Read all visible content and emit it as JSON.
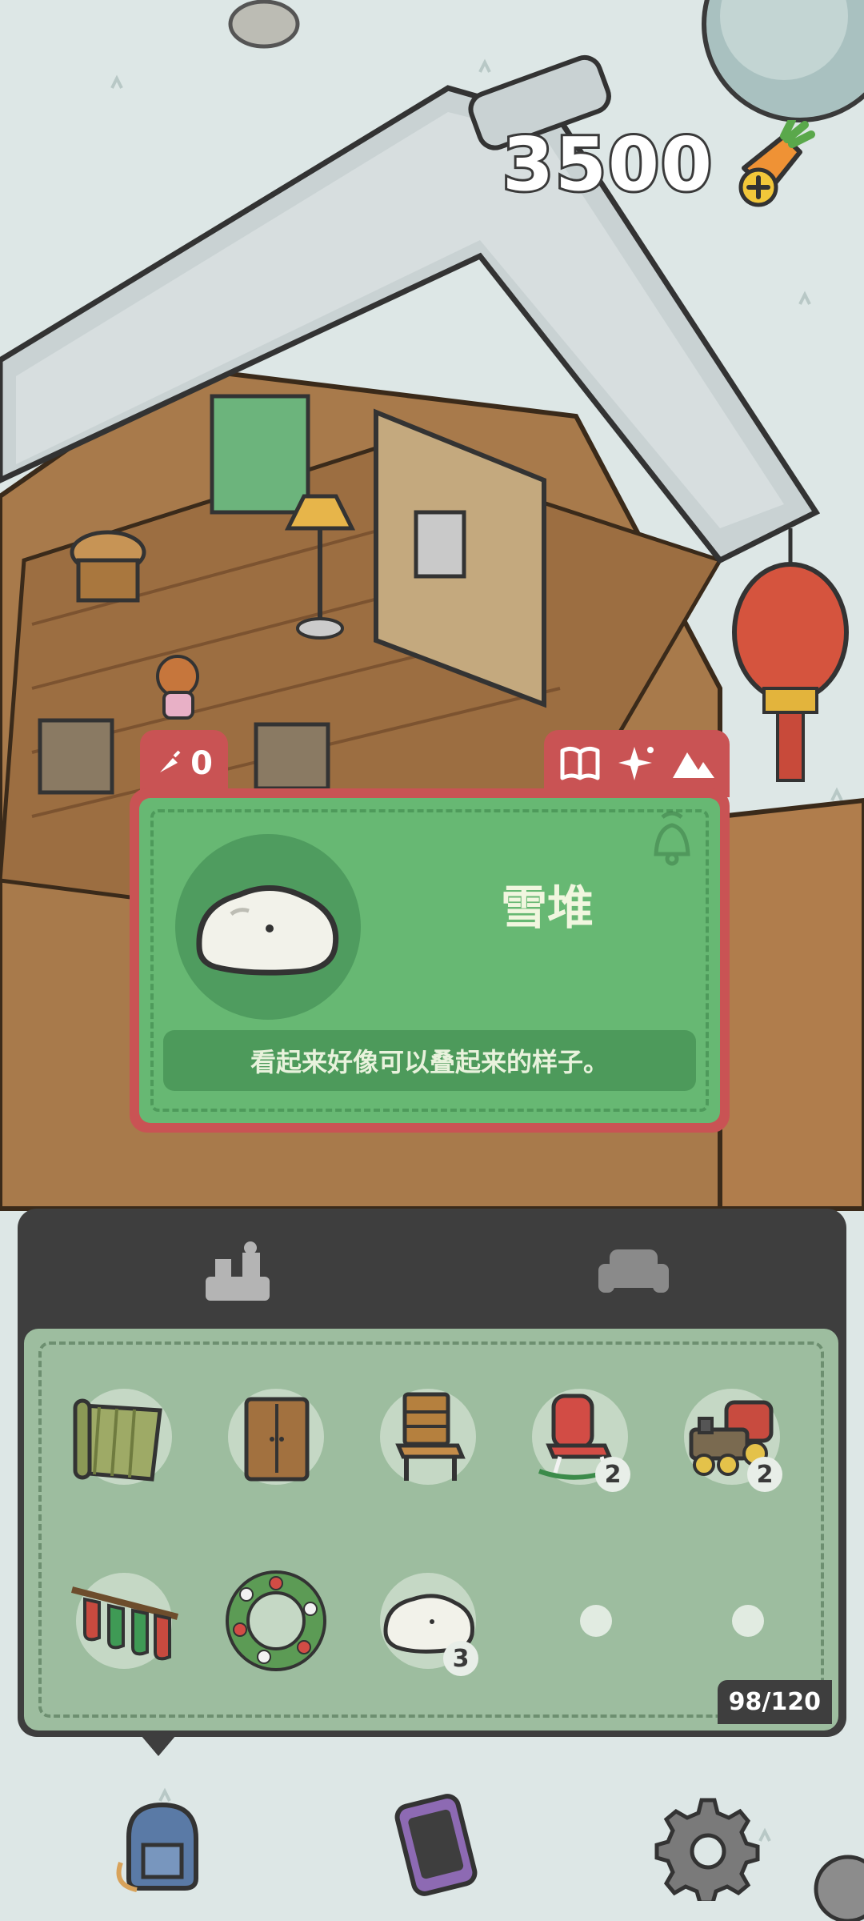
{
  "currency": {
    "amount": "3500",
    "icon": "carrot-add-icon"
  },
  "detail": {
    "tab_count": "0",
    "item_name": "雪堆",
    "item_description": "看起来好像可以叠起来的样子。",
    "actions": [
      "book-icon",
      "sparkle-icon",
      "mountain-icon"
    ]
  },
  "inventory": {
    "tabs": [
      "furniture-set-icon",
      "sofa-icon"
    ],
    "items": [
      {
        "icon": "bamboo-mat-icon",
        "count": ""
      },
      {
        "icon": "wardrobe-icon",
        "count": ""
      },
      {
        "icon": "wooden-chair-icon",
        "count": ""
      },
      {
        "icon": "rocking-chair-icon",
        "count": "2"
      },
      {
        "icon": "toy-train-icon",
        "count": "2"
      },
      {
        "icon": "stockings-icon",
        "count": ""
      },
      {
        "icon": "wreath-icon",
        "count": ""
      },
      {
        "icon": "snow-pile-icon",
        "count": "3"
      }
    ],
    "capacity": "98/120"
  },
  "nav": [
    "backpack-icon",
    "phone-icon",
    "settings-gear-icon"
  ],
  "colors": {
    "card_red": "#c95354",
    "card_green": "#67b873",
    "panel_dark": "#3e3e3e",
    "panel_green": "#9dbd9f"
  }
}
